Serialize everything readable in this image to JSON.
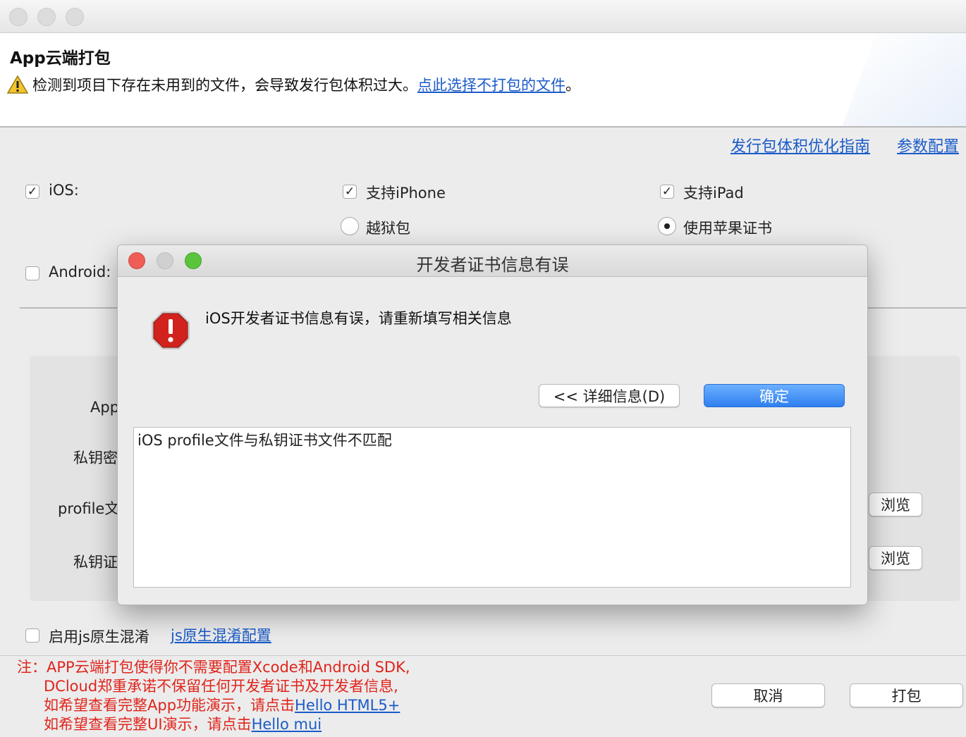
{
  "window": {
    "title": "App云端打包",
    "warning_text": "检测到项目下存在未用到的文件，会导致发行包体积过大。",
    "warning_link": "点此选择不打包的文件",
    "warning_suffix": "。"
  },
  "toplinks": {
    "size_guide": "发行包体积优化指南",
    "param_config": "参数配置"
  },
  "platforms": {
    "ios_label": "iOS:",
    "support_iphone": "支持iPhone",
    "support_ipad": "支持iPad",
    "jailbreak": "越狱包",
    "apple_cert": "使用苹果证书",
    "android_label": "Android:"
  },
  "form": {
    "app_label": "App",
    "key_password_label": "私钥密",
    "profile_label": "profile文",
    "key_cert_label": "私钥证",
    "browse1": "浏览",
    "browse2": "浏览"
  },
  "obfuscation": {
    "label": "启用js原生混淆",
    "config_link": "js原生混淆配置"
  },
  "note": {
    "line1": "注：APP云端打包使得你不需要配置Xcode和Android SDK,",
    "line2": "DCloud郑重承诺不保留任何开发者证书及开发者信息,",
    "line3_prefix": "如希望查看完整App功能演示，请点击",
    "line3_link": "Hello HTML5+",
    "line4_prefix": "如希望查看完整UI演示，请点击",
    "line4_link": "Hello mui"
  },
  "buttons": {
    "cancel": "取消",
    "pack": "打包"
  },
  "dialog": {
    "title": "开发者证书信息有误",
    "message": "iOS开发者证书信息有误，请重新填写相关信息",
    "details_button": "<< 详细信息(D)",
    "ok_button": "确定",
    "details_text": "iOS profile文件与私钥证书文件不匹配"
  },
  "colors": {
    "link": "#1a5bc8",
    "note_red": "#e0241b",
    "primary_button": "#2f7ff0",
    "close_red": "#ee5e57",
    "zoom_green": "#5bc43d"
  },
  "state": {
    "ios_checked": true,
    "iphone_checked": true,
    "ipad_checked": true,
    "android_checked": false,
    "jailbreak_selected": false,
    "apple_cert_selected": true,
    "obfuscation_checked": false
  }
}
